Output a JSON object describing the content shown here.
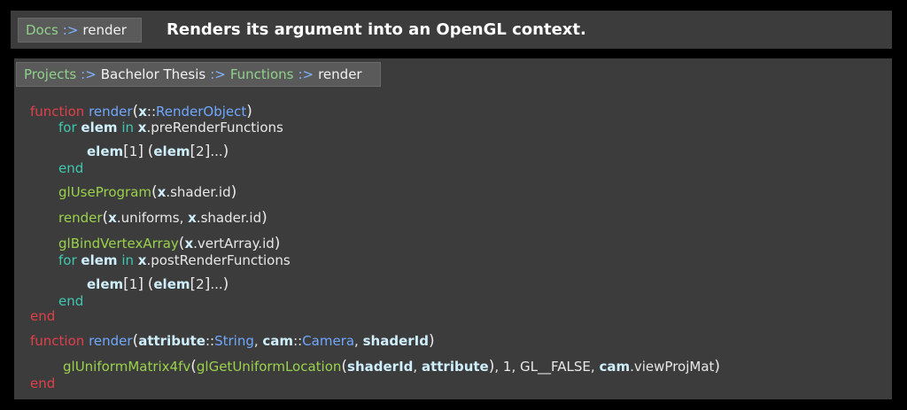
{
  "header": {
    "breadcrumb": [
      {
        "label": "Docs",
        "link": true
      },
      {
        "label": "render",
        "link": false
      }
    ],
    "separator": ":>",
    "description": "Renders its argument into an OpenGL context."
  },
  "panel": {
    "breadcrumb": [
      {
        "label": "Projects",
        "link": true
      },
      {
        "label": "Bachelor Thesis",
        "link": false
      },
      {
        "label": "Functions",
        "link": true
      },
      {
        "label": "render",
        "link": false
      }
    ]
  },
  "code": {
    "kw_function": "function",
    "kw_for": "for",
    "kw_in": "in",
    "kw_end": "end",
    "fn_render": "render",
    "x": "x",
    "type_sep": "::",
    "type_renderobject": "RenderObject",
    "elem": "elem",
    "pre_render_functions": ".preRenderFunctions",
    "post_render_functions": ".postRenderFunctions",
    "idx1": "1",
    "idx2": "2",
    "ellipsis": "...",
    "gl_use_program": "glUseProgram",
    "shader_id": ".shader.id",
    "uniforms": ".uniforms",
    "comma": ",",
    "gl_bind_vertex_array": "glBindVertexArray",
    "vert_array_id": ".vertArray.id",
    "attribute": "attribute",
    "type_string": "String",
    "cam": "cam",
    "type_camera": "Camera",
    "shaderid": "shaderId",
    "gl_uniform_matrix": "glUniformMatrix4fv",
    "gl_get_uniform_location": "glGetUniformLocation",
    "one": "1",
    "gl_false": "GL__FALSE",
    "view_proj_mat": ".viewProjMat"
  },
  "colors": {
    "keyword": "#e0404a",
    "function_name": "#6fa8ff",
    "gl_call": "#9ad24c",
    "inner_keyword": "#40c8b0",
    "link": "#8fd18b"
  }
}
